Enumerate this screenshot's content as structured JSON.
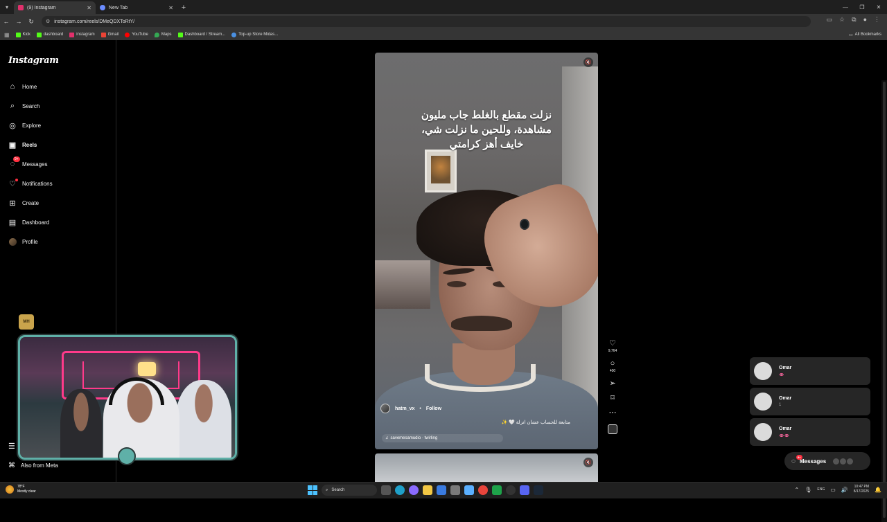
{
  "browser": {
    "tabs": [
      {
        "title": "(9) Instagram",
        "active": true,
        "favicon_color": "#e1306c"
      },
      {
        "title": "New Tab",
        "active": false,
        "favicon_color": "#6b8cff"
      }
    ],
    "url": "instagram.com/reels/DMeQDXToRtY/",
    "bookmarks": [
      {
        "label": "Kick",
        "color": "#53fc18"
      },
      {
        "label": "dashboard",
        "color": "#53fc18"
      },
      {
        "label": "instagram",
        "color": "#e1306c"
      },
      {
        "label": "Gmail",
        "color": "#ea4335"
      },
      {
        "label": "YouTube",
        "color": "#ff0000"
      },
      {
        "label": "Maps",
        "color": "#34a853"
      },
      {
        "label": "Dashboard / Stream...",
        "color": "#53fc18"
      },
      {
        "label": "Top-up Store Midas...",
        "color": "#4a90e2"
      }
    ],
    "all_bookmarks": "All Bookmarks"
  },
  "sidebar": {
    "logo": "Instagram",
    "items": [
      {
        "label": "Home",
        "icon": "home-icon"
      },
      {
        "label": "Search",
        "icon": "search-icon"
      },
      {
        "label": "Explore",
        "icon": "compass-icon"
      },
      {
        "label": "Reels",
        "icon": "reels-icon"
      },
      {
        "label": "Messages",
        "icon": "messenger-icon",
        "badge": "9+"
      },
      {
        "label": "Notifications",
        "icon": "heart-icon"
      },
      {
        "label": "Create",
        "icon": "plus-square-icon"
      },
      {
        "label": "Dashboard",
        "icon": "dashboard-icon"
      },
      {
        "label": "Profile",
        "icon": "avatar"
      }
    ],
    "more": "",
    "also_from_meta": "Also from Meta"
  },
  "reel": {
    "caption_lines": [
      "نزلت مقطع بالغلط جاب مليون",
      "مشاهدة، وللحين ما نزلت شي،",
      "خايف أهز كرامتي"
    ],
    "username": "hatm_vx",
    "separator": "•",
    "follow": "Follow",
    "description": "متابعة للحساب عشان انزلة 🤍 ✨",
    "audio": "savemesamudio · twirling",
    "likes": "9,764",
    "comments": "400"
  },
  "messages_previews": [
    {
      "name": "Omar",
      "preview": "👄"
    },
    {
      "name": "Omar",
      "preview": "1"
    },
    {
      "name": "Omar",
      "preview": "👄👄"
    }
  ],
  "messages_pill": {
    "label": "Messages",
    "badge": "9+"
  },
  "taskbar": {
    "temp": "78°F",
    "weather": "Mostly clear",
    "search": "Search",
    "lang": "ENG",
    "time": "10:47 PM",
    "date": "8/17/2025"
  }
}
